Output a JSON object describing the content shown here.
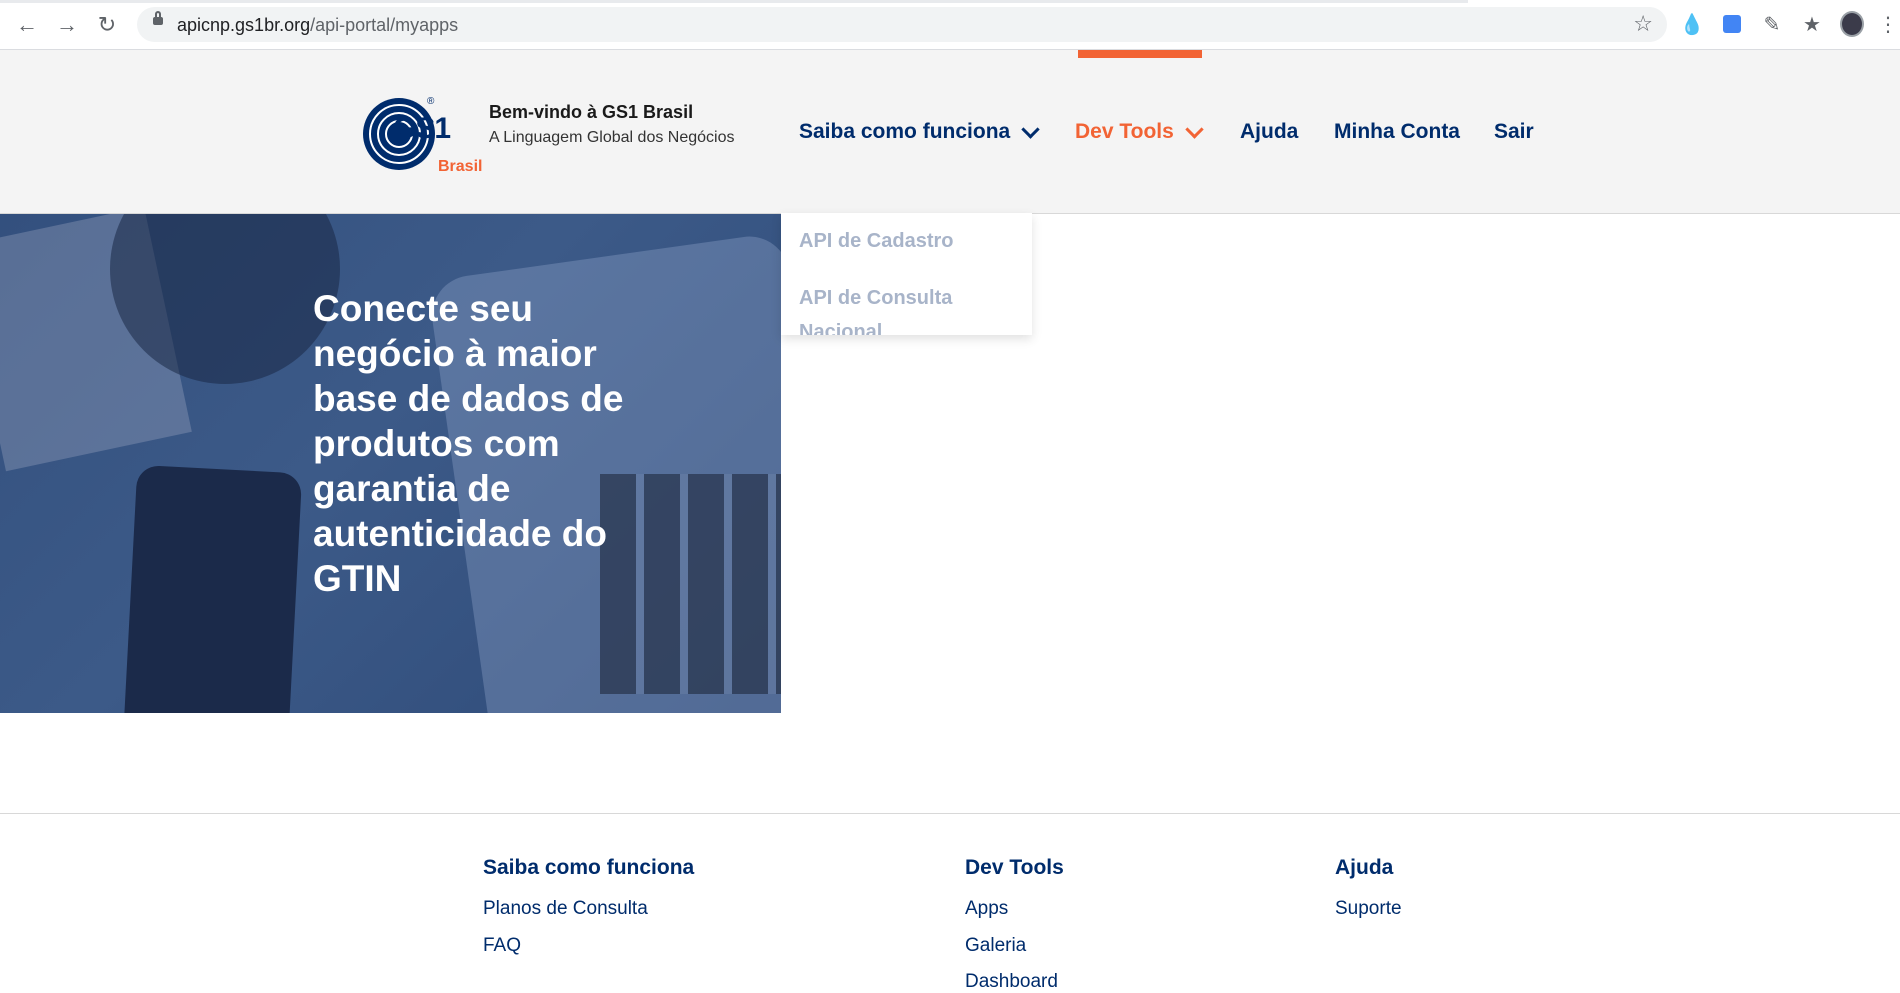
{
  "browser": {
    "url_host": "apicnp.gs1br.org",
    "url_path": "/api-portal/myapps"
  },
  "header": {
    "logo_text": "GS1",
    "logo_sub": "Brasil",
    "welcome": "Bem-vindo à GS1 Brasil",
    "tagline": "A Linguagem Global dos Negócios",
    "menu": [
      {
        "label": "Saiba como funciona"
      },
      {
        "label": "Dev Tools"
      },
      {
        "label": "Ajuda"
      },
      {
        "label": "Minha Conta"
      },
      {
        "label": "Sair"
      }
    ]
  },
  "dropdown": {
    "items": [
      "API de Cadastro",
      "API de Consulta",
      "Nacional"
    ]
  },
  "hero": {
    "headline": "Conecte seu negócio à maior base de dados de produtos com garantia de autenticidade do GTIN"
  },
  "footer": {
    "columns": [
      {
        "title": "Saiba como funciona",
        "links": [
          "Planos de Consulta",
          "FAQ"
        ]
      },
      {
        "title": "Dev Tools",
        "links": [
          "Apps",
          "Galeria",
          "Dashboard"
        ]
      },
      {
        "title": "Ajuda",
        "links": [
          "Suporte"
        ]
      }
    ]
  },
  "colors": {
    "brand_navy": "#002c6c",
    "brand_orange": "#f26334",
    "dropdown_text": "#a8b4c9"
  }
}
